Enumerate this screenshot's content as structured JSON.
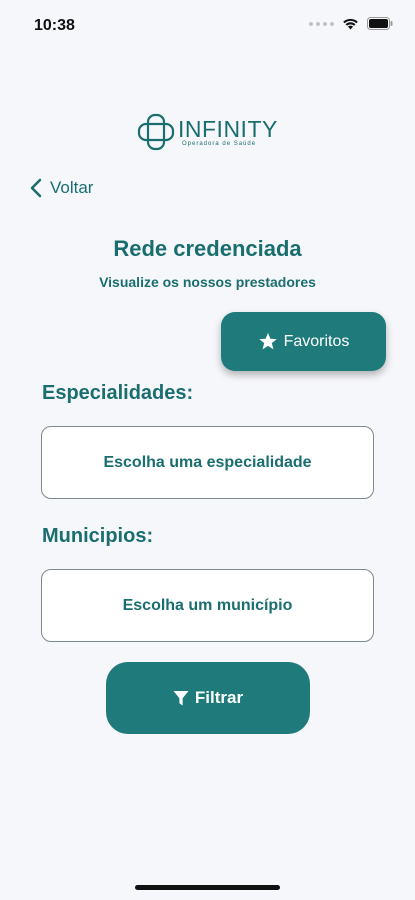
{
  "status_bar": {
    "time": "10:38"
  },
  "logo": {
    "name": "INFINITY",
    "tagline": "Operadora de Saúde"
  },
  "nav": {
    "back_label": "Voltar"
  },
  "header": {
    "title": "Rede credenciada",
    "subtitle": "Visualize os nossos prestadores"
  },
  "favorites": {
    "label": "Favoritos",
    "icon": "star-icon"
  },
  "specialties": {
    "label": "Especialidades:",
    "placeholder": "Escolha uma especialidade"
  },
  "municipalities": {
    "label": "Municipios:",
    "placeholder": "Escolha um município"
  },
  "filter": {
    "label": "Filtrar",
    "icon": "filter-icon"
  },
  "colors": {
    "primary": "#1f7a7b",
    "text": "#1a6e6f",
    "background": "#f6f7fb"
  }
}
